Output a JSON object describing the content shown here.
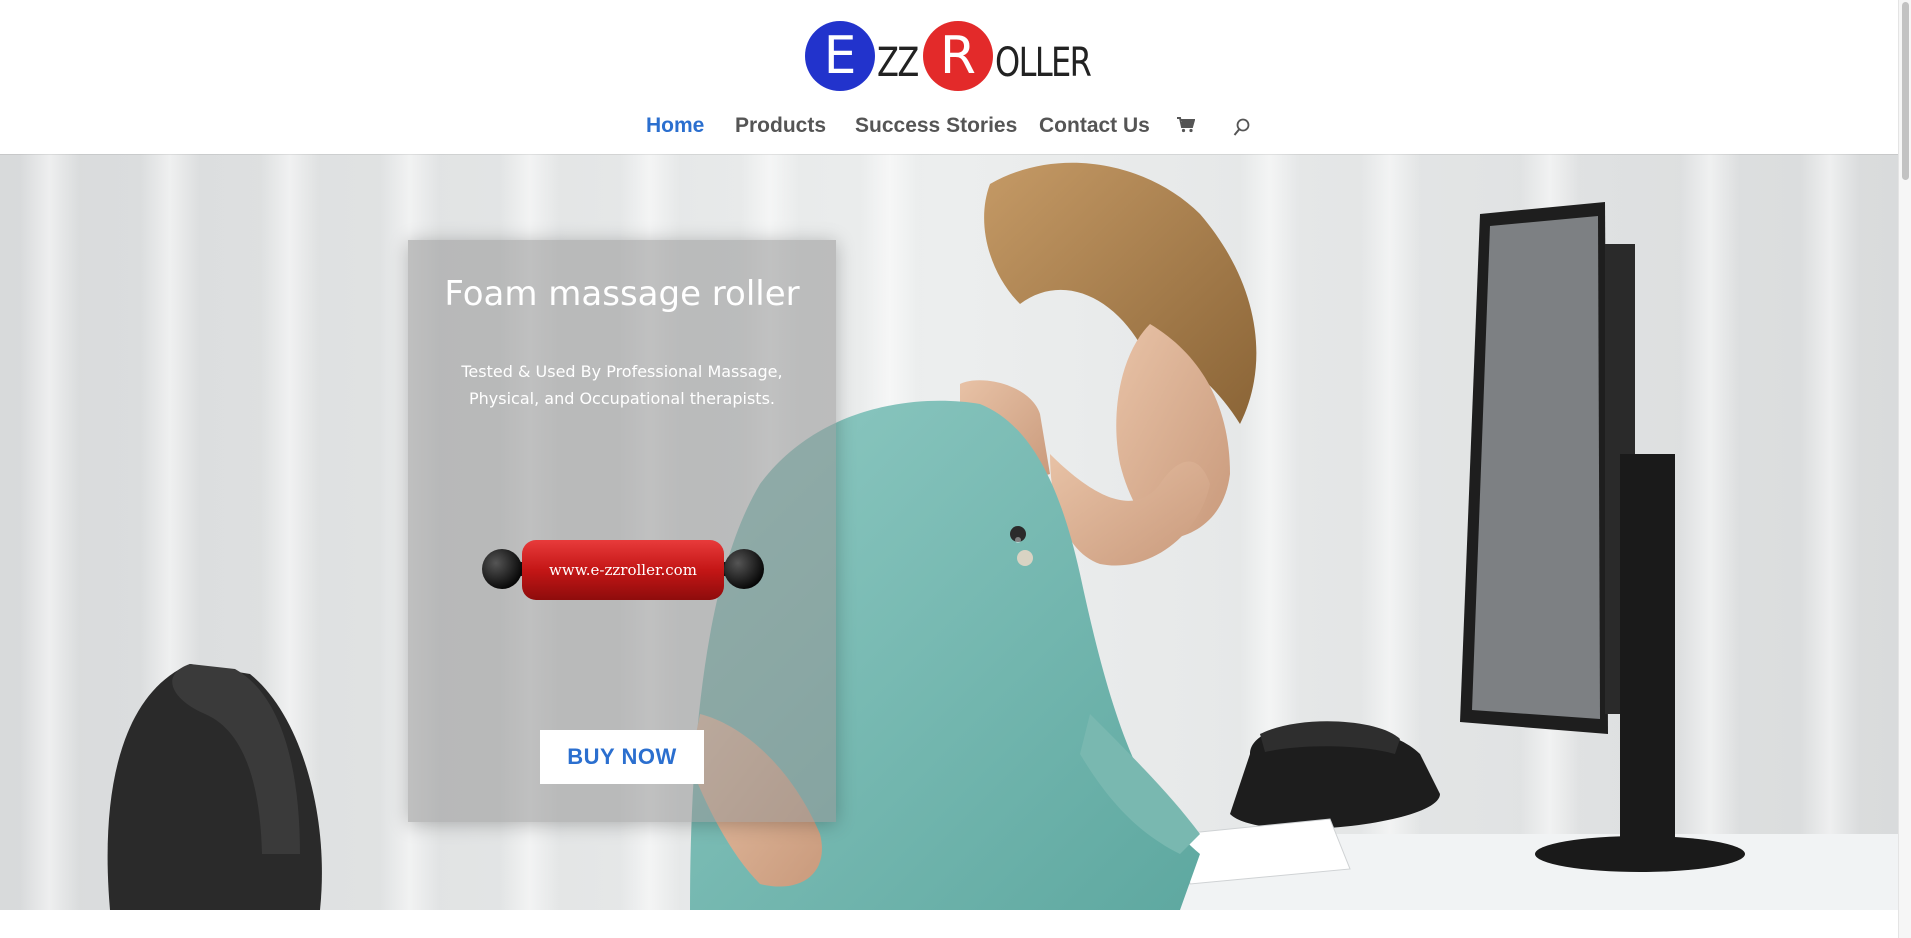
{
  "brand": {
    "logo_letter_1": "E",
    "logo_part_1": "ZZ",
    "logo_letter_2": "R",
    "logo_part_2": "OLLER",
    "colors": {
      "blue": "#2233cc",
      "red": "#e32a2a"
    }
  },
  "nav": {
    "items": [
      {
        "label": "Home",
        "active": true
      },
      {
        "label": "Products",
        "active": false
      },
      {
        "label": "Success Stories",
        "active": false
      },
      {
        "label": "Contact Us",
        "active": false
      }
    ],
    "cart_icon": "shopping-cart-icon",
    "search_icon": "search-icon",
    "accent_color": "#2b6fcf"
  },
  "hero": {
    "title": "Foam massage roller",
    "subtitle": "Tested & Used By Professional Massage, Physical, and Occupational therapists.",
    "product_label": "www.e-zzroller.com",
    "cta_label": "BUY NOW"
  }
}
